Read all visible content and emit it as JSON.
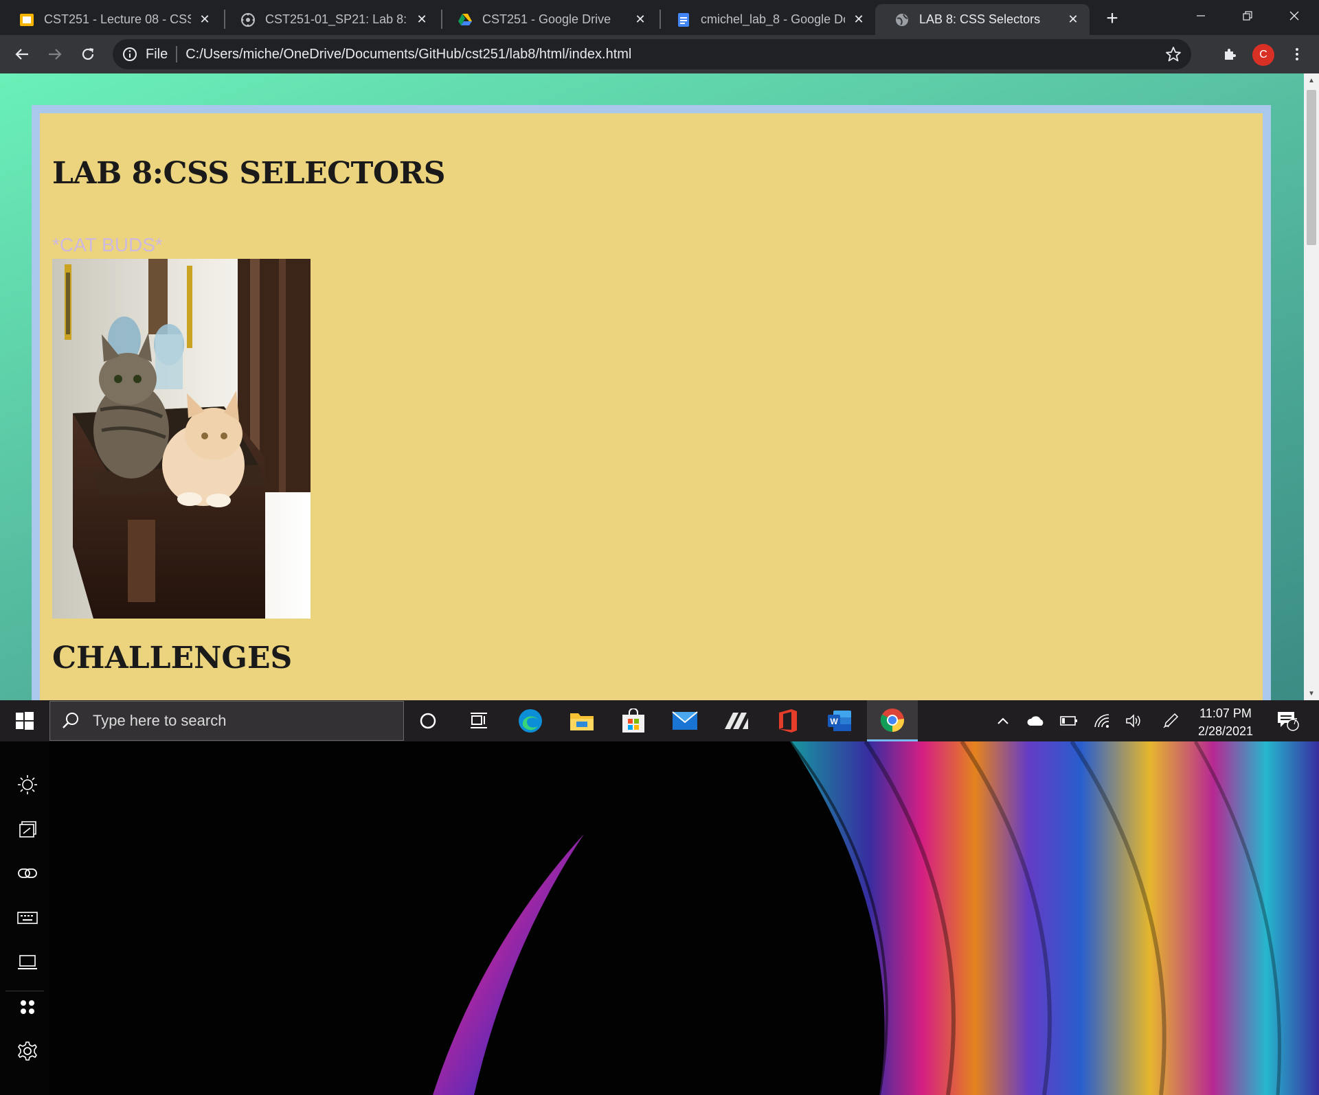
{
  "browser": {
    "tabs": [
      {
        "title": "CST251 - Lecture 08 - CSS S",
        "favicon": "slides-icon",
        "active": false
      },
      {
        "title": "CST251-01_SP21: Lab 8: CSS",
        "favicon": "canvas-icon",
        "active": false
      },
      {
        "title": "CST251 - Google Drive",
        "favicon": "google-drive-icon",
        "active": false
      },
      {
        "title": "cmichel_lab_8 - Google Doc",
        "favicon": "google-docs-icon",
        "active": false
      },
      {
        "title": "LAB 8: CSS Selectors",
        "favicon": "globe-icon",
        "active": true
      }
    ],
    "address_bar": {
      "scheme_label": "File",
      "url": "C:/Users/miche/OneDrive/Documents/GitHub/cst251/lab8/html/index.html"
    },
    "profile_initial": "C",
    "profile_color": "#d93025"
  },
  "page": {
    "heading": "LAB 8:CSS SELECTORS",
    "subheading": "*CAT BUDS*",
    "image_subject": "two kittens sitting on a dresser",
    "section_heading": "CHALLENGES",
    "colors": {
      "background": "#5cc9a6",
      "panel": "#ecd47e",
      "panel_border": "#a9c8ec",
      "subheading_text": "#cdb9e0"
    }
  },
  "taskbar": {
    "search_placeholder": "Type here to search",
    "pinned": [
      "cortana-icon",
      "task-view-icon",
      "edge-icon",
      "file-explorer-icon",
      "store-icon",
      "mail-icon",
      "app-icon",
      "office-icon",
      "word-icon",
      "chrome-icon"
    ],
    "active_app": "chrome-icon",
    "tray_icons": [
      "chevron-up-icon",
      "onedrive-icon",
      "battery-icon",
      "wifi-icon",
      "volume-icon",
      "pen-icon"
    ],
    "time": "11:07 PM",
    "date": "2/28/2021",
    "notification_count": "7"
  },
  "side_panel": {
    "icons": [
      "brightness-icon",
      "project-icon",
      "link-icon",
      "keyboard-icon",
      "laptop-icon",
      "apps-icon",
      "settings-icon"
    ]
  }
}
